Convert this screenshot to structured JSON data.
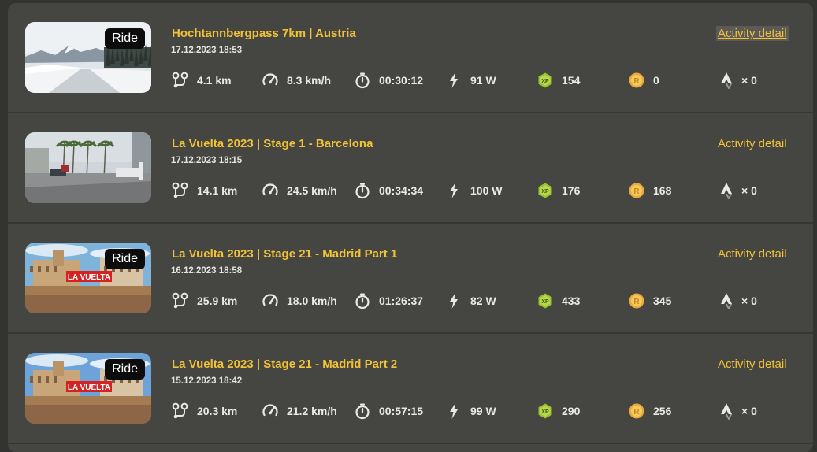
{
  "activities": [
    {
      "title": "Hochtannbergpass 7km | Austria",
      "date": "17.12.2023 18:53",
      "badge": "Ride",
      "scene": "snow",
      "distance": "4.1 km",
      "speed": "8.3 km/h",
      "duration": "00:30:12",
      "power": "91 W",
      "xp": "154",
      "coins": "0",
      "strava": "× 0",
      "detail_label": "Activity detail",
      "detail_active": true
    },
    {
      "title": "La Vuelta 2023 | Stage 1 - Barcelona",
      "date": "17.12.2023 18:15",
      "badge": "",
      "scene": "street",
      "distance": "14.1 km",
      "speed": "24.5 km/h",
      "duration": "00:34:34",
      "power": "100 W",
      "xp": "176",
      "coins": "168",
      "strava": "× 0",
      "detail_label": "Activity detail",
      "detail_active": false
    },
    {
      "title": "La Vuelta 2023 | Stage 21 - Madrid Part 1",
      "date": "16.12.2023 18:58",
      "badge": "Ride",
      "scene": "madrid1",
      "thumb_text": "LA VUELTA",
      "distance": "25.9 km",
      "speed": "18.0 km/h",
      "duration": "01:26:37",
      "power": "82 W",
      "xp": "433",
      "coins": "345",
      "strava": "× 0",
      "detail_label": "Activity detail",
      "detail_active": false
    },
    {
      "title": "La Vuelta 2023 | Stage 21 - Madrid Part 2",
      "date": "15.12.2023 18:42",
      "badge": "Ride",
      "scene": "madrid2",
      "thumb_text": "LA VUELTA",
      "distance": "20.3 km",
      "speed": "21.2 km/h",
      "duration": "00:57:15",
      "power": "99 W",
      "xp": "290",
      "coins": "256",
      "strava": "× 0",
      "detail_label": "Activity detail",
      "detail_active": false
    }
  ],
  "icons": {
    "distance": "route-icon",
    "speed": "speedometer-icon",
    "duration": "stopwatch-icon",
    "power": "lightning-icon",
    "xp": "xp-hexagon-icon",
    "coins": "coin-icon",
    "strava": "strava-icon"
  },
  "colors": {
    "accent": "#f2c237",
    "panel": "#454542",
    "background": "#333331",
    "xp": "#9cc12f",
    "coin": "#f1b94a"
  }
}
